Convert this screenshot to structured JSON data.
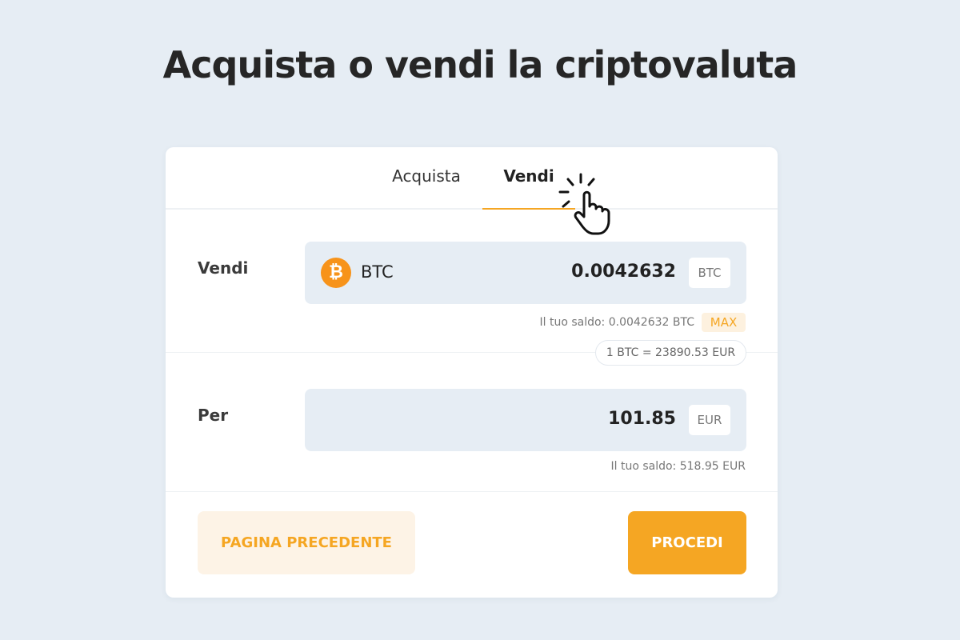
{
  "page": {
    "title": "Acquista o vendi la criptovaluta"
  },
  "tabs": {
    "buy": "Acquista",
    "sell": "Vendi",
    "active": "sell"
  },
  "sell_row": {
    "label": "Vendi",
    "coin_icon": "bitcoin-icon",
    "coin_symbol": "₿",
    "coin_name": "BTC",
    "amount": "0.0042632",
    "unit": "BTC",
    "balance": "Il tuo saldo: 0.0042632 BTC",
    "max_label": "MAX"
  },
  "rate": "1 BTC = 23890.53 EUR",
  "receive_row": {
    "label": "Per",
    "amount": "101.85",
    "unit": "EUR",
    "balance": "Il tuo saldo: 518.95 EUR"
  },
  "buttons": {
    "back": "PAGINA PRECEDENTE",
    "next": "PROCEDI"
  },
  "colors": {
    "accent": "#f5a623",
    "bitcoin": "#f7931a",
    "background": "#e6edf4"
  }
}
